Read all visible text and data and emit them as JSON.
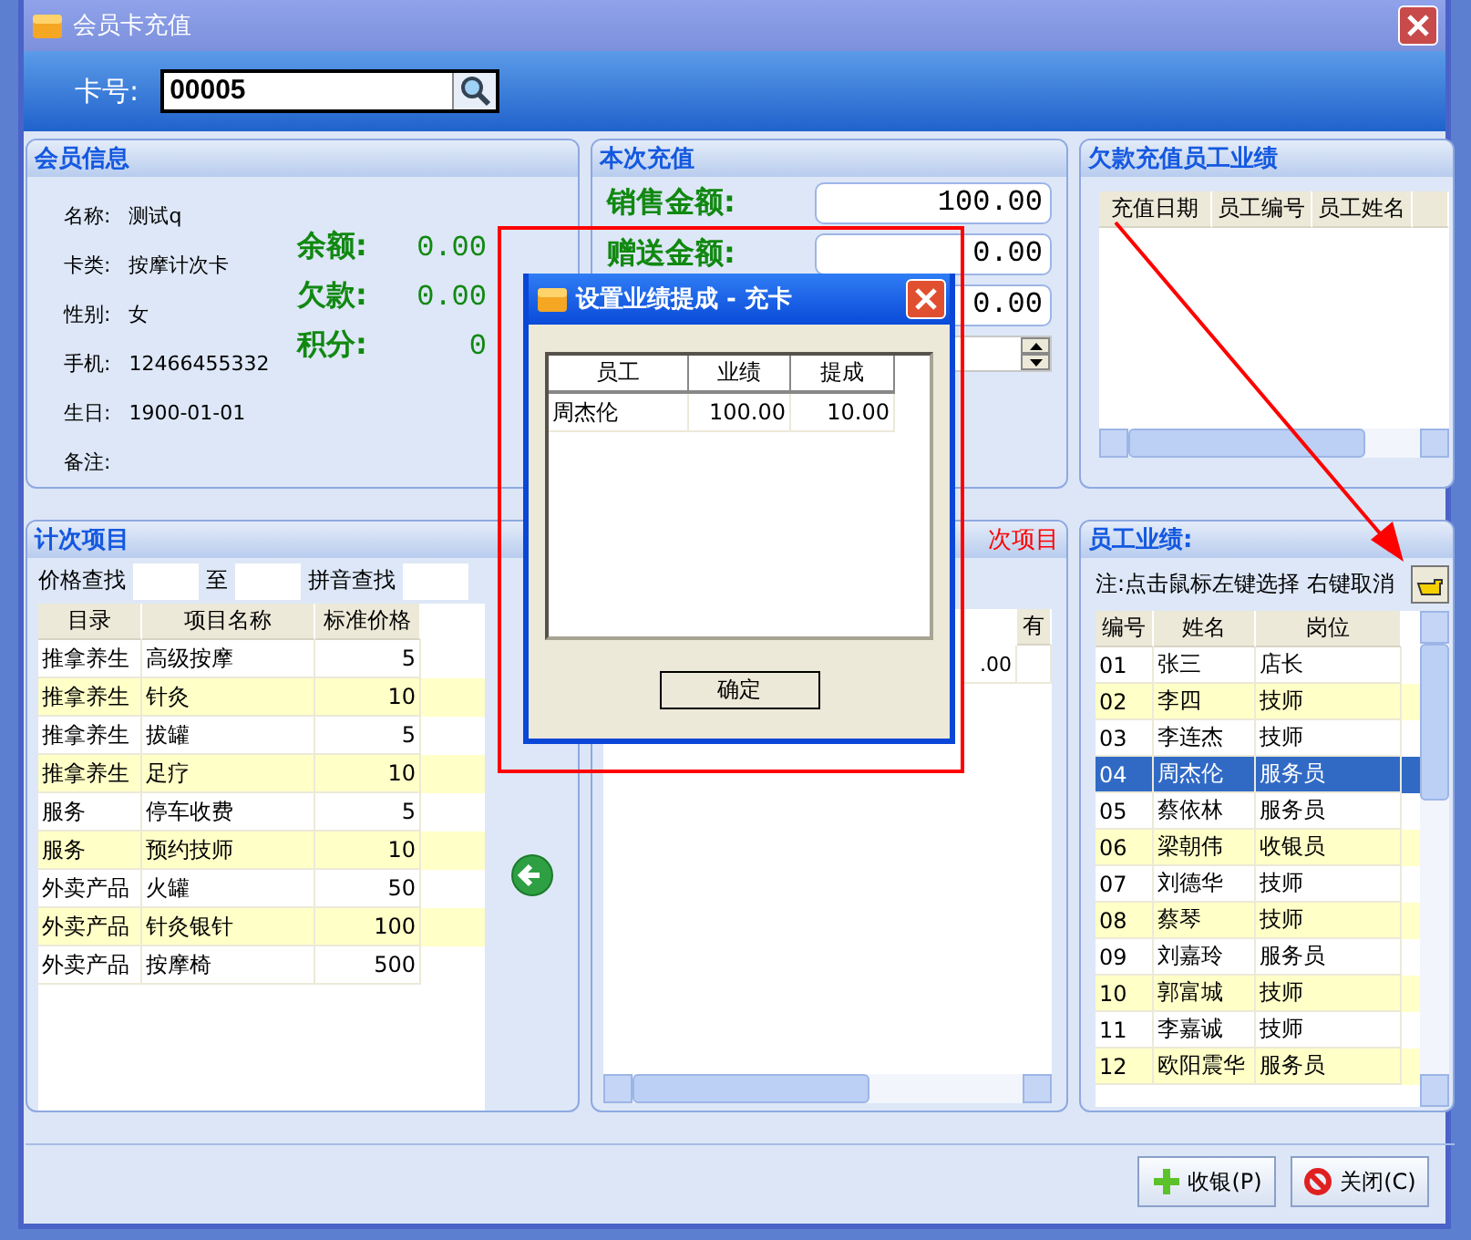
{
  "window": {
    "title": "会员卡充值"
  },
  "card": {
    "label": "卡号:",
    "value": "00005"
  },
  "member_info": {
    "title": "会员信息",
    "fields": [
      {
        "label": "名称:",
        "value": "测试q"
      },
      {
        "label": "卡类:",
        "value": "按摩计次卡"
      },
      {
        "label": "性别:",
        "value": "女"
      },
      {
        "label": "手机:",
        "value": "12466455332"
      },
      {
        "label": "生日:",
        "value": "1900-01-01"
      },
      {
        "label": "备注:"
      }
    ],
    "balances": [
      {
        "label": "余额:",
        "value": "0.00"
      },
      {
        "label": "欠款:",
        "value": "0.00"
      },
      {
        "label": "积分:",
        "value": "0"
      }
    ]
  },
  "recharge": {
    "title": "本次充值",
    "rows": [
      {
        "label": "销售金额:",
        "value": "100.00"
      },
      {
        "label": "赠送金额:",
        "value": "0.00"
      },
      {
        "value": "0.00"
      }
    ]
  },
  "debt_staff": {
    "title": "欠款充值员工业绩",
    "columns": [
      "充值日期",
      "员工编号",
      "员工姓名"
    ]
  },
  "count_items": {
    "title": "计次项目",
    "filters": [
      "价格查找",
      "至",
      "拼音查找"
    ],
    "columns": [
      "目录",
      "项目名称",
      "标准价格"
    ],
    "rows": [
      [
        "推拿养生",
        "高级按摩",
        "5"
      ],
      [
        "推拿养生",
        "针灸",
        "10"
      ],
      [
        "推拿养生",
        "拔罐",
        "5"
      ],
      [
        "推拿养生",
        "足疗",
        "10"
      ],
      [
        "服务",
        "停车收费",
        "5"
      ],
      [
        "服务",
        "预约技师",
        "10"
      ],
      [
        "外卖产品",
        "火罐",
        "50"
      ],
      [
        "外卖产品",
        "针灸银针",
        "100"
      ],
      [
        "外卖产品",
        "按摩椅",
        "500"
      ]
    ]
  },
  "chosen_items": {
    "title": "次项目",
    "last_column": "有",
    "value_fragment": ".00"
  },
  "staff": {
    "title": "员工业绩:",
    "note": "注:点击鼠标左键选择 右键取消",
    "columns": [
      "编号",
      "姓名",
      "岗位"
    ],
    "rows": [
      {
        "cells": [
          "01",
          "张三",
          "店长"
        ],
        "selected": false
      },
      {
        "cells": [
          "02",
          "李四",
          "技师"
        ],
        "selected": false
      },
      {
        "cells": [
          "03",
          "李连杰",
          "技师"
        ],
        "selected": false
      },
      {
        "cells": [
          "04",
          "周杰伦",
          "服务员"
        ],
        "selected": true
      },
      {
        "cells": [
          "05",
          "蔡依林",
          "服务员"
        ],
        "selected": false
      },
      {
        "cells": [
          "06",
          "梁朝伟",
          "收银员"
        ],
        "selected": false
      },
      {
        "cells": [
          "07",
          "刘德华",
          "技师"
        ],
        "selected": false
      },
      {
        "cells": [
          "08",
          "蔡琴",
          "技师"
        ],
        "selected": false
      },
      {
        "cells": [
          "09",
          "刘嘉玲",
          "服务员"
        ],
        "selected": false
      },
      {
        "cells": [
          "10",
          "郭富城",
          "技师"
        ],
        "selected": false
      },
      {
        "cells": [
          "11",
          "李嘉诚",
          "技师"
        ],
        "selected": false
      },
      {
        "cells": [
          "12",
          "欧阳震华",
          "服务员"
        ],
        "selected": false
      }
    ]
  },
  "buttons": [
    {
      "label": "收银(P)",
      "kind": "add"
    },
    {
      "label": "关闭(C)",
      "kind": "close"
    }
  ],
  "dialog": {
    "title": "设置业绩提成 - 充卡",
    "columns": [
      "员工",
      "业绩",
      "提成"
    ],
    "rows": [
      [
        "周杰伦",
        "100.00",
        "10.00"
      ]
    ],
    "button": "确定"
  }
}
